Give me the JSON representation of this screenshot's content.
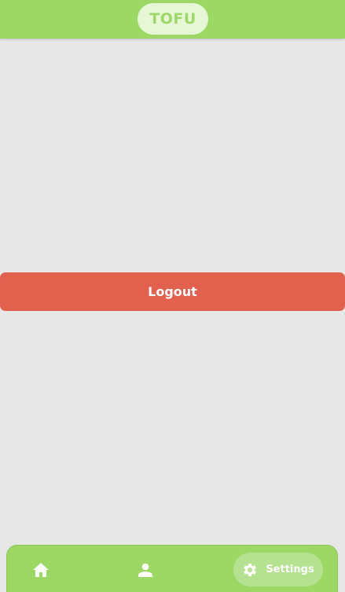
{
  "header": {
    "logo_text": "TOFU"
  },
  "main": {
    "logout_label": "Logout"
  },
  "bottom_nav": {
    "items": [
      {
        "icon": "home-icon",
        "label": ""
      },
      {
        "icon": "person-icon",
        "label": ""
      },
      {
        "icon": "gear-icon",
        "label": "Settings",
        "active": true
      }
    ]
  },
  "colors": {
    "brand_green": "#9dd865",
    "logo_pill_bg": "#e6f6d6",
    "active_tab_bg": "#b4e290",
    "logout_red": "#e2604e",
    "page_bg": "#e7e7e7"
  }
}
